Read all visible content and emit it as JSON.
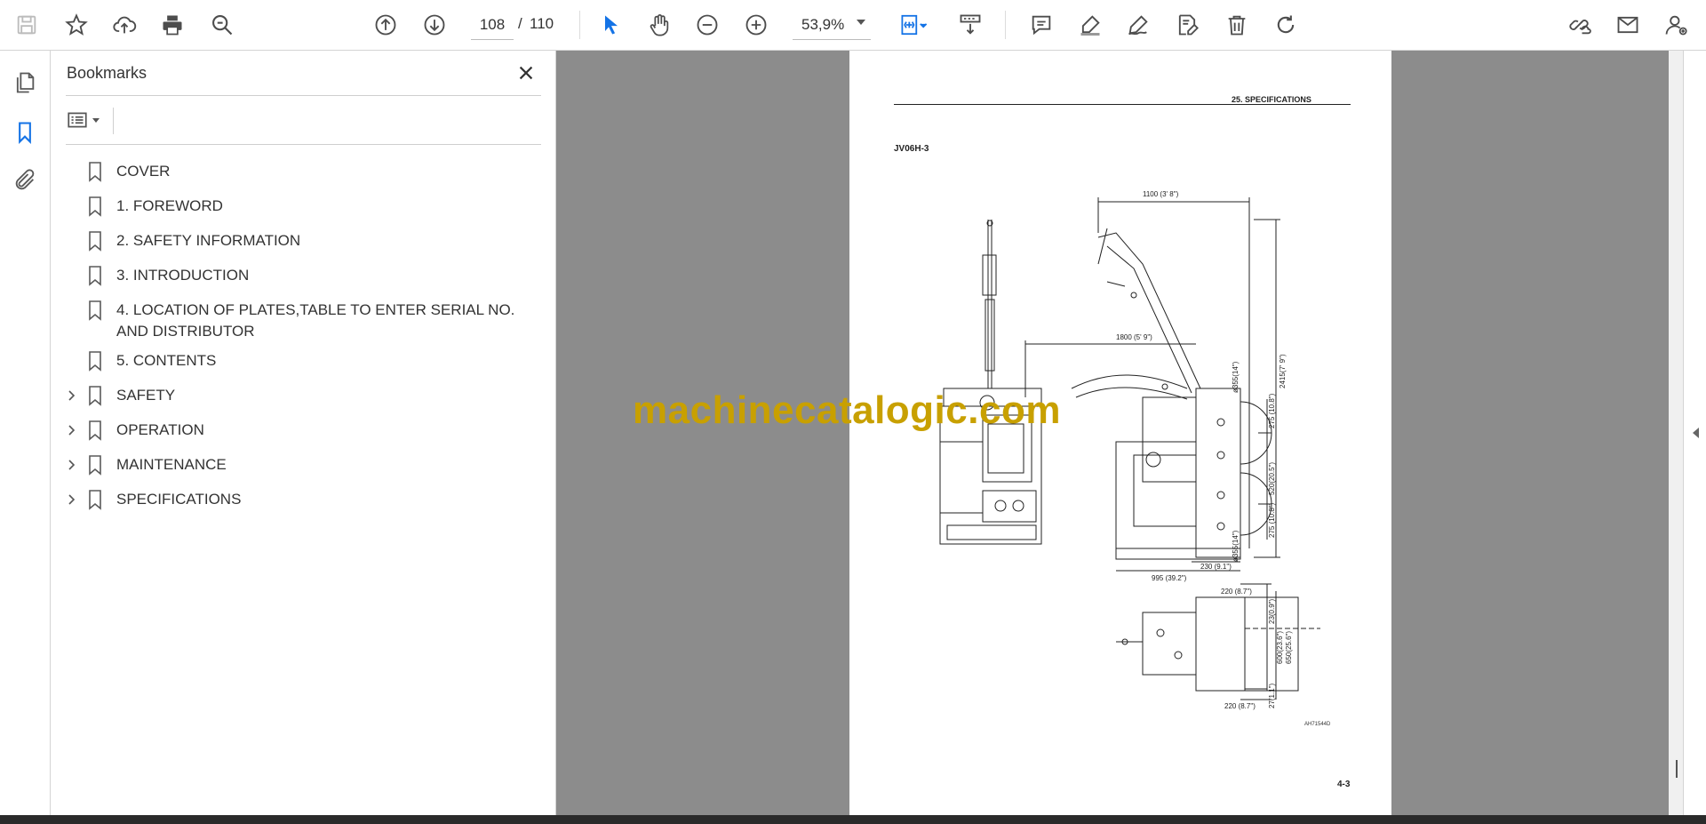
{
  "toolbar": {
    "page_current": "108",
    "page_separator": "/",
    "page_total": "110",
    "zoom": "53,9%",
    "icons": [
      "save-icon",
      "star-icon",
      "cloud-upload-icon",
      "print-icon",
      "search-zoom-icon",
      "page-up-icon",
      "page-down-icon",
      "select-cursor-icon",
      "hand-icon",
      "zoom-out-icon",
      "zoom-in-icon",
      "fit-page-icon",
      "scroll-mode-icon",
      "comment-icon",
      "highlight-icon",
      "draw-icon",
      "edit-text-icon",
      "delete-icon",
      "redo-icon",
      "share-link-icon",
      "email-icon",
      "account-icon"
    ]
  },
  "bookmarks": {
    "title": "Bookmarks",
    "items": [
      {
        "label": "COVER",
        "expandable": false
      },
      {
        "label": "1. FOREWORD",
        "expandable": false
      },
      {
        "label": "2. SAFETY INFORMATION",
        "expandable": false
      },
      {
        "label": "3. INTRODUCTION",
        "expandable": false
      },
      {
        "label": "4. LOCATION OF PLATES,TABLE TO ENTER SERIAL NO. AND DISTRIBUTOR",
        "expandable": false
      },
      {
        "label": "5. CONTENTS",
        "expandable": false
      },
      {
        "label": "SAFETY",
        "expandable": true
      },
      {
        "label": "OPERATION",
        "expandable": true
      },
      {
        "label": "MAINTENANCE",
        "expandable": true
      },
      {
        "label": "SPECIFICATIONS",
        "expandable": true
      }
    ]
  },
  "document": {
    "header": "25. SPECIFICATIONS",
    "model": "JV06H-3",
    "drawing_code": "AH71544D",
    "page_number": "4-3",
    "watermark": "machinecatalogic.com",
    "dimensions": {
      "d1": "1100 (3' 8\")",
      "d2": "1800 (5' 9\")",
      "d3": "2415(7' 9\")",
      "d4": "275 (10.8\")",
      "d5": "520(20.5\")",
      "d6": "275 (10.8\")",
      "d7": "995 (39.2\")",
      "d8": "230 (9.1\")",
      "d9": "220 (8.7\")",
      "d10": "ø355(14\")",
      "d11": "ø355(14\")",
      "d12": "600(23.6\")",
      "d13": "650(25.6\")",
      "d14": "220 (8.7\")",
      "d15": "23(0.9\")",
      "d16": "27(1.1\")"
    }
  }
}
